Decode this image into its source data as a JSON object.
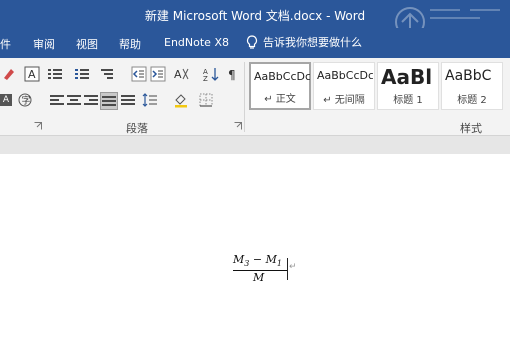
{
  "window": {
    "title": "新建 Microsoft Word 文档.docx  -  Word"
  },
  "menu": {
    "tabs": [
      "件",
      "审阅",
      "视图",
      "帮助",
      "EndNote X8"
    ],
    "tell_me": "告诉我你想要做什么"
  },
  "ribbon": {
    "styles": [
      {
        "sample": "AaBbCcDc",
        "name": "↵ 正文",
        "selected": true
      },
      {
        "sample": "AaBbCcDc",
        "name": "↵ 无间隔",
        "selected": false
      },
      {
        "sample": "AaBl",
        "name": "标题 1",
        "selected": false
      },
      {
        "sample": "AaBbC",
        "name": "标题 2",
        "selected": false
      }
    ],
    "groups": {
      "paragraph": "段落",
      "styles": "样式"
    }
  },
  "document": {
    "equation": {
      "num_a": "M",
      "num_a_sub": "3",
      "minus": " − ",
      "num_b": "M",
      "num_b_sub": "1",
      "den": "M"
    },
    "paragraph_mark": "↵"
  },
  "colors": {
    "title_bar": "#2b579a",
    "ribbon_bg": "#f3f3f3",
    "page_bg": "#ffffff"
  }
}
